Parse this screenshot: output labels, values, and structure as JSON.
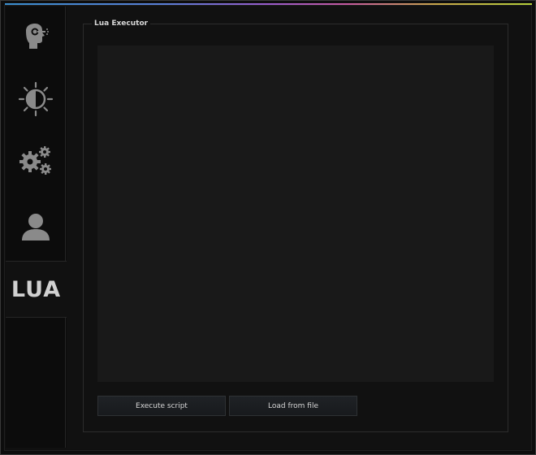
{
  "sidebar": {
    "tabs": [
      {
        "id": "rage",
        "icon": "head-target-icon"
      },
      {
        "id": "visuals",
        "icon": "half-sun-icon"
      },
      {
        "id": "misc",
        "icon": "gears-icon"
      },
      {
        "id": "players",
        "icon": "person-icon"
      },
      {
        "id": "lua",
        "label": "LUA",
        "active": true
      }
    ]
  },
  "lua_executor": {
    "title": "Lua Executor",
    "editor_value": "",
    "execute_label": "Execute script",
    "load_label": "Load from file"
  },
  "colors": {
    "accent_gradient": [
      "#3a8fd0",
      "#9a5ccc",
      "#c65aa0",
      "#b5cf3a"
    ],
    "icon": "#8a8a8a",
    "editor_bg": "#191919"
  }
}
